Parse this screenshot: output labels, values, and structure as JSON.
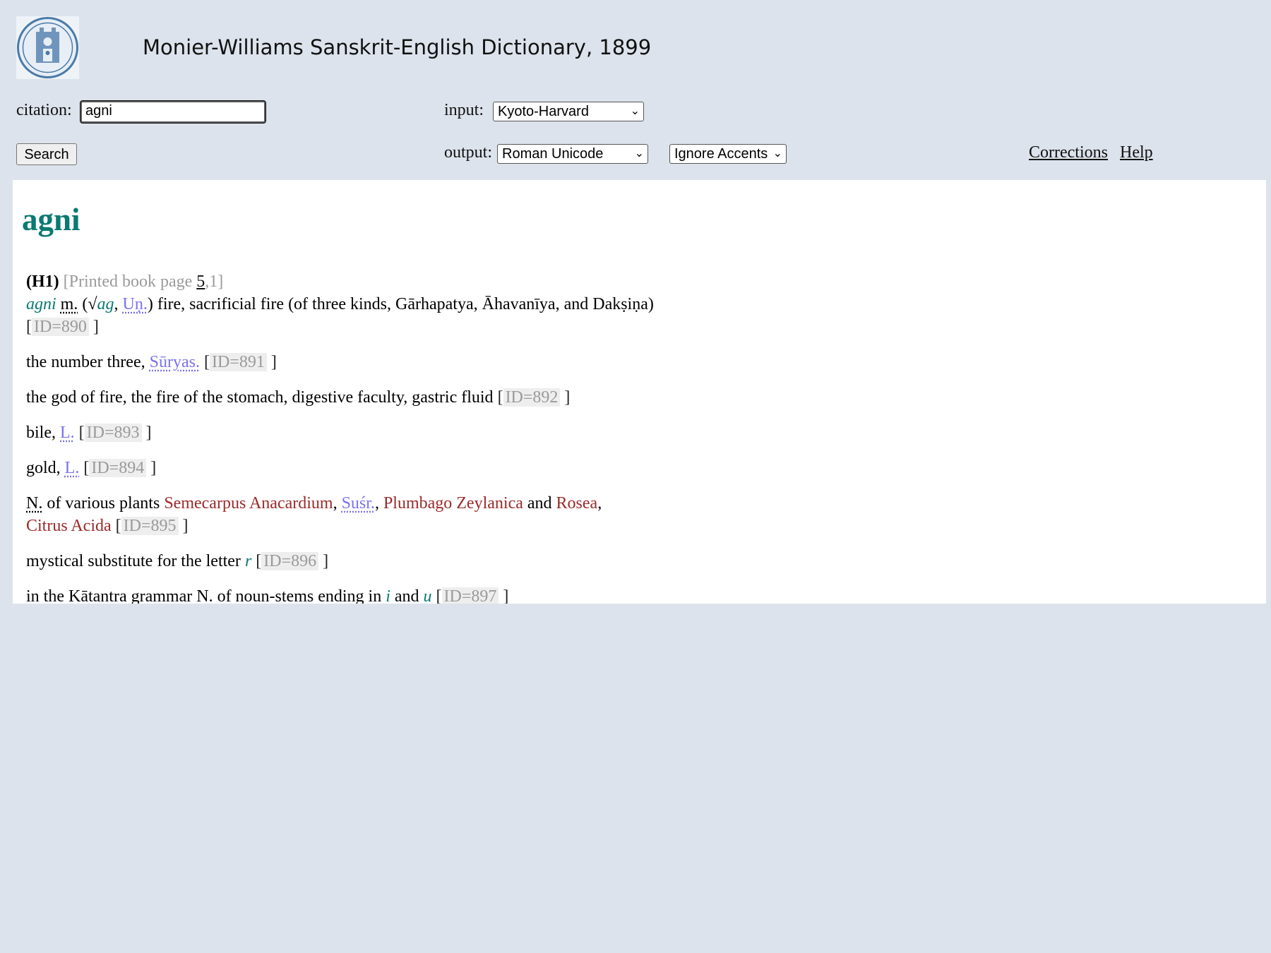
{
  "header": {
    "title": "Monier-Williams Sanskrit-English Dictionary, 1899",
    "logo_icon": "university-seal-icon"
  },
  "form": {
    "citation_label": "citation:",
    "citation_value": "agni",
    "input_label": "input:",
    "input_selected": "Kyoto-Harvard",
    "output_label": "output:",
    "output_selected": "Roman Unicode",
    "accents_selected": "Ignore Accents",
    "search_label": "Search"
  },
  "links": {
    "corrections": "Corrections",
    "help": "Help"
  },
  "entry": {
    "headword": "agni",
    "h1": "(H1)",
    "printed_page_prefix": "[Printed book page ",
    "printed_page_num": "5",
    "printed_page_suffix": ",1]",
    "senses": [
      {
        "id": "ID=890"
      },
      {
        "text": "the number three, ",
        "ref": "Sūryas.",
        "id": "ID=891"
      },
      {
        "text": "the god of fire, the fire of the stomach, digestive faculty, gastric fluid ",
        "id": "ID=892"
      },
      {
        "text": "bile, ",
        "ref": "L.",
        "id": "ID=893"
      },
      {
        "text": "gold, ",
        "ref": "L.",
        "id": "ID=894"
      },
      {
        "id": "ID=895"
      },
      {
        "text": "mystical substitute for the letter ",
        "letter": "r",
        "id": "ID=896"
      },
      {
        "text": "in the Kātantra grammar N. of noun-stems ending in ",
        "v1": "i",
        "and": " and ",
        "v2": "u",
        "id": "ID=897"
      }
    ],
    "s1": {
      "word": "agni",
      "gender": "m.",
      "open": " (√",
      "root": "ag",
      "comma": ", ",
      "ref": "Uṇ.",
      "rest": ") fire, sacrificial fire (of three kinds, Gārhapatya, Āhavanīya, and Dakṣiṇa) "
    },
    "s6": {
      "n": "N.",
      "t1": " of various plants ",
      "b1": "Semecarpus Anacardium",
      "c1": ", ",
      "ref": "Suśr.",
      "c2": ", ",
      "b2": "Plumbago Zeylanica",
      "t2": " and ",
      "b3": "Rosea",
      "c3": ", ",
      "b4": "Citrus Acida"
    }
  }
}
